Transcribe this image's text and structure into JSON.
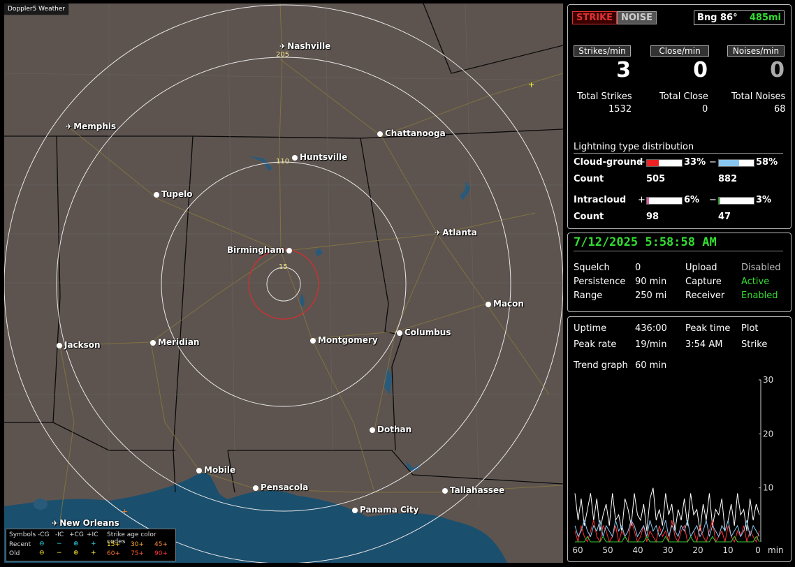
{
  "app_title": "Doppler5 Weather",
  "cities": [
    {
      "name": "Nashville",
      "type": "plane"
    },
    {
      "name": "Memphis",
      "type": "plane"
    },
    {
      "name": "Chattanooga",
      "type": "dot"
    },
    {
      "name": "Huntsville",
      "type": "dot"
    },
    {
      "name": "Tupelo",
      "type": "dot"
    },
    {
      "name": "Atlanta",
      "type": "plane"
    },
    {
      "name": "Birmingham",
      "type": "dot-right"
    },
    {
      "name": "Macon",
      "type": "dot"
    },
    {
      "name": "Columbus",
      "type": "dot"
    },
    {
      "name": "Montgomery",
      "type": "dot"
    },
    {
      "name": "Jackson",
      "type": "dot"
    },
    {
      "name": "Meridian",
      "type": "dot"
    },
    {
      "name": "Dothan",
      "type": "dot"
    },
    {
      "name": "Mobile",
      "type": "dot"
    },
    {
      "name": "Pensacola",
      "type": "dot"
    },
    {
      "name": "Tallahassee",
      "type": "dot"
    },
    {
      "name": "Panama City",
      "type": "dot"
    },
    {
      "name": "New Orleans",
      "type": "plane"
    }
  ],
  "range_rings": [
    "205",
    "110",
    "15"
  ],
  "legend": {
    "symbols": "Symbols",
    "cg_minus": "-CG",
    "ic_minus": "-IC",
    "cg_plus": "+CG",
    "ic_plus": "+IC",
    "age_title": "Strike age color codes",
    "recent": "Recent",
    "old": "Old",
    "recent_ages": [
      "15+",
      "30+",
      "45+"
    ],
    "old_ages": [
      "60+",
      "75+",
      "90+"
    ]
  },
  "header": {
    "strike": "STRIKE",
    "noise": "NOISE",
    "bearing": "Bng 86°",
    "distance": "485mi"
  },
  "rates": {
    "strikes_label": "Strikes/min",
    "close_label": "Close/min",
    "noises_label": "Noises/min",
    "strikes": "3",
    "close": "0",
    "noises": "0",
    "total_strikes_label": "Total Strikes",
    "total_close_label": "Total Close",
    "total_noises_label": "Total Noises",
    "total_strikes": "1532",
    "total_close": "0",
    "total_noises": "68"
  },
  "distribution": {
    "title": "Lightning type distribution",
    "cg_label": "Cloud-ground",
    "ic_label": "Intracloud",
    "count_label": "Count",
    "plus": "+",
    "minus": "−",
    "cg_plus_pct": "33%",
    "cg_minus_pct": "58%",
    "ic_plus_pct": "6%",
    "ic_minus_pct": "3%",
    "cg_plus_count": "505",
    "cg_minus_count": "882",
    "ic_plus_count": "98",
    "ic_minus_count": "47",
    "cg_plus_fill": 0.33,
    "cg_minus_fill": 0.58,
    "ic_plus_fill": 0.06,
    "ic_minus_fill": 0.03
  },
  "status": {
    "datetime": "7/12/2025 5:58:58 AM",
    "squelch_label": "Squelch",
    "squelch": "0",
    "persistence_label": "Persistence",
    "persistence": "90 min",
    "range_label": "Range",
    "range": "250 mi",
    "upload_label": "Upload",
    "upload": "Disabled",
    "capture_label": "Capture",
    "capture": "Active",
    "receiver_label": "Receiver",
    "receiver": "Enabled"
  },
  "stats": {
    "uptime_label": "Uptime",
    "uptime": "436:00",
    "peak_time_label": "Peak time",
    "peak_time": "3:54 AM",
    "plot_label": "Plot",
    "plot": "Strike",
    "peak_rate_label": "Peak rate",
    "peak_rate": "19/min",
    "trend_label": "Trend graph",
    "trend": "60 min"
  },
  "colors": {
    "strike": "#e03030",
    "active": "#33dd33",
    "cg_plus": "#ee2222",
    "cg_minus": "#88c8f0",
    "ic_plus": "#e060a0",
    "ic_minus": "#33cc33",
    "map": "#5d5450",
    "water": "#1b4f6e"
  },
  "chart_data": {
    "type": "line",
    "x_ticks": [
      "60",
      "50",
      "40",
      "30",
      "20",
      "10",
      "0"
    ],
    "x_unit": "min",
    "y_ticks": [
      "30",
      "20",
      "10"
    ],
    "ylim": [
      0,
      30
    ],
    "series": [
      {
        "color": "#ffffff",
        "values": [
          9,
          4,
          8,
          3,
          6,
          9,
          4,
          8,
          2,
          5,
          7,
          3,
          9,
          4,
          5,
          2,
          8,
          6,
          3,
          9,
          5,
          4,
          7,
          2,
          8,
          10,
          4,
          6,
          3,
          9,
          5,
          7,
          2,
          6,
          4,
          8,
          3,
          9,
          5,
          6,
          2,
          7,
          4,
          9,
          3,
          6,
          5,
          8,
          2,
          4,
          7,
          3,
          9,
          5,
          6,
          2,
          8,
          4,
          7,
          5
        ]
      },
      {
        "color": "#ff3333",
        "values": [
          2,
          0,
          3,
          1,
          0,
          2,
          4,
          1,
          0,
          3,
          2,
          0,
          1,
          3,
          0,
          2,
          1,
          0,
          4,
          2,
          0,
          1,
          3,
          0,
          2,
          1,
          0,
          3,
          1,
          2,
          0,
          4,
          1,
          0,
          2,
          3,
          0,
          1,
          2,
          0,
          3,
          1,
          0,
          2,
          4,
          0,
          1,
          2,
          0,
          3,
          1,
          0,
          2,
          1,
          3,
          0,
          2,
          1,
          0,
          2
        ]
      },
      {
        "color": "#88c8f0",
        "values": [
          3,
          1,
          2,
          4,
          2,
          1,
          3,
          2,
          4,
          1,
          3,
          2,
          1,
          4,
          2,
          3,
          1,
          2,
          4,
          3,
          1,
          2,
          3,
          1,
          4,
          2,
          3,
          1,
          2,
          4,
          1,
          3,
          2,
          1,
          3,
          2,
          4,
          1,
          2,
          3,
          1,
          2,
          4,
          1,
          3,
          2,
          1,
          3,
          2,
          4,
          1,
          2,
          3,
          1,
          2,
          4,
          1,
          3,
          2,
          1
        ]
      },
      {
        "color": "#33cc33",
        "values": [
          0,
          0,
          0,
          0,
          1,
          0,
          0,
          0,
          0,
          1,
          0,
          0,
          0,
          0,
          0,
          0,
          1,
          0,
          0,
          0,
          0,
          0,
          0,
          1,
          0,
          0,
          0,
          0,
          0,
          1,
          0,
          0,
          0,
          0,
          0,
          0,
          0,
          1,
          0,
          0,
          0,
          0,
          0,
          0,
          1,
          0,
          0,
          0,
          0,
          0,
          0,
          1,
          0,
          0,
          0,
          0,
          0,
          0,
          1,
          0
        ]
      }
    ]
  }
}
